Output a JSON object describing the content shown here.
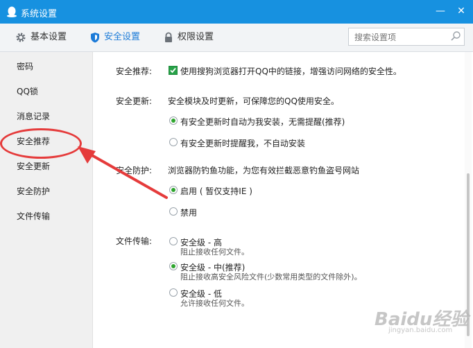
{
  "window": {
    "title": "系统设置",
    "minimize": "—",
    "close": "✕"
  },
  "toolbar": {
    "tabs": [
      {
        "label": "基本设置",
        "icon": "gear-icon"
      },
      {
        "label": "安全设置",
        "icon": "shield-icon"
      },
      {
        "label": "权限设置",
        "icon": "lock-icon"
      }
    ],
    "active_tab": "安全设置",
    "search_placeholder": "搜索设置项"
  },
  "sidebar": {
    "items": [
      {
        "label": "密码"
      },
      {
        "label": "QQ锁"
      },
      {
        "label": "消息记录"
      },
      {
        "label": "安全推荐"
      },
      {
        "label": "安全更新"
      },
      {
        "label": "安全防护"
      },
      {
        "label": "文件传输"
      }
    ],
    "highlighted": "安全推荐"
  },
  "sections": {
    "recommend": {
      "label": "安全推荐:",
      "checkbox_label": "使用搜狗浏览器打开QQ中的链接，增强访问网络的安全性。",
      "checked": true
    },
    "update": {
      "label": "安全更新:",
      "desc": "安全模块及时更新，可保障您的QQ使用安全。",
      "options": [
        {
          "label": "有安全更新时自动为我安装，无需提醒(推荐)",
          "selected": true
        },
        {
          "label": "有安全更新时提醒我，不自动安装",
          "selected": false
        }
      ]
    },
    "protect": {
      "label": "安全防护:",
      "desc": "浏览器防钓鱼功能，为您有效拦截恶意钓鱼盗号网站",
      "options": [
        {
          "label": "启用 ( 暂仅支持IE )",
          "selected": true
        },
        {
          "label": "禁用",
          "selected": false
        }
      ]
    },
    "transfer": {
      "label": "文件传输:",
      "options": [
        {
          "label": "安全级 - 高",
          "sub": "阻止接收任何文件。",
          "selected": false
        },
        {
          "label": "安全级 - 中(推荐)",
          "sub": "阻止接收高安全风险文件(少数常用类型的文件除外)。",
          "selected": true
        },
        {
          "label": "安全级 - 低",
          "sub": "允许接收任何文件。",
          "selected": false
        }
      ]
    }
  },
  "watermark": {
    "text": "Baidu经验",
    "sub": "jingyan.baidu.com"
  },
  "colors": {
    "titlebar": "#1791e0",
    "accent": "#1c7bd8",
    "annotation": "#e53b3b",
    "radio_on": "#2ea52e"
  }
}
